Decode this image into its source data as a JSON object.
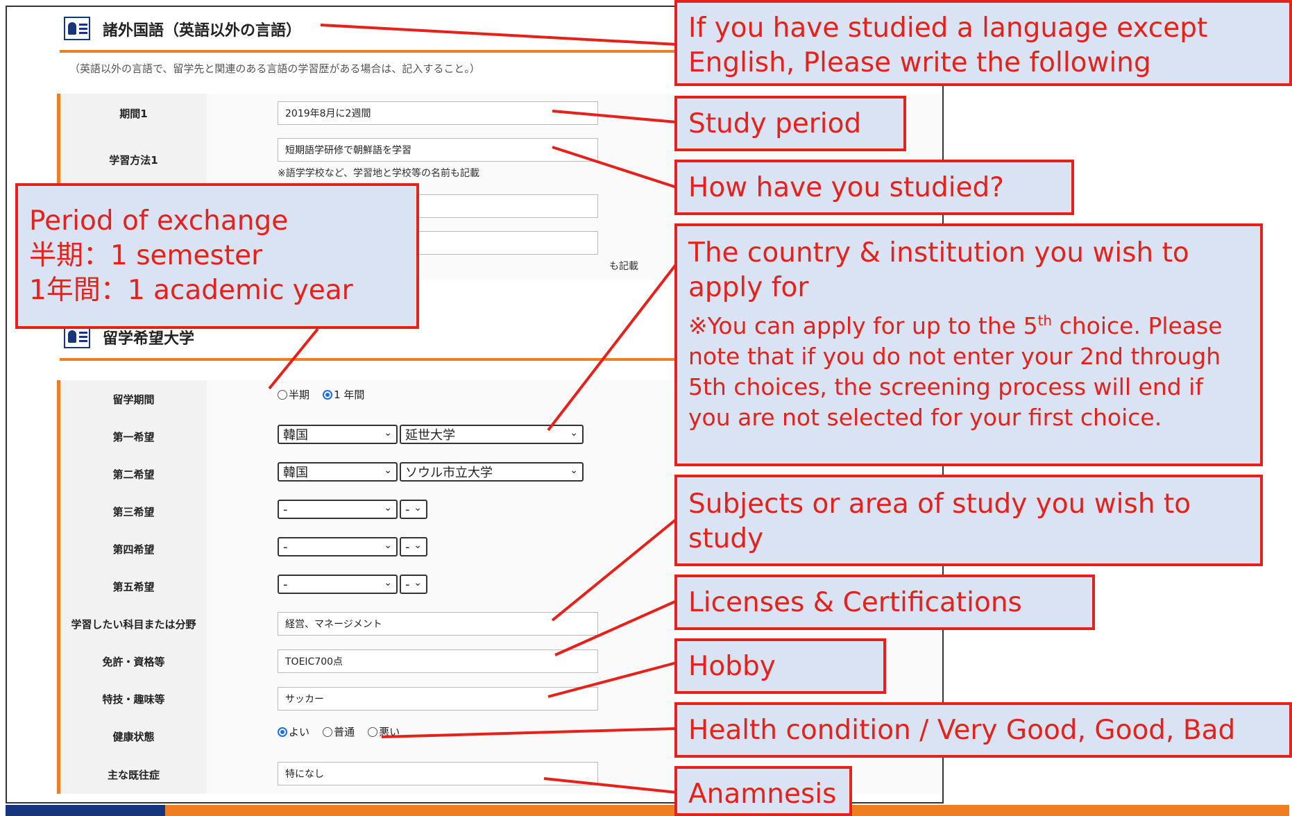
{
  "section1": {
    "title": "諸外国語（英語以外の言語）",
    "note": "（英語以外の言語で、留学先と関連のある言語の学習歴がある場合は、記入すること。）",
    "rows": [
      {
        "label": "期間1",
        "value": "2019年8月に2週間"
      },
      {
        "label": "学習方法1",
        "value": "短期語学研修で朝鮮語を学習",
        "sub": "※語学学校など、学習地と学校等の名前も記載"
      },
      {
        "label": "",
        "value": ""
      },
      {
        "label": "",
        "value": "",
        "sub": "も記載"
      }
    ]
  },
  "section2": {
    "title": "留学希望大学",
    "period": {
      "label": "留学期間",
      "options": [
        "半期",
        "1 年間"
      ],
      "selected": "1 年間"
    },
    "choices": [
      {
        "label": "第一希望",
        "country": "韓国",
        "university": "延世大学"
      },
      {
        "label": "第二希望",
        "country": "韓国",
        "university": "ソウル市立大学"
      },
      {
        "label": "第三希望",
        "country": "-",
        "university": "-"
      },
      {
        "label": "第四希望",
        "country": "-",
        "university": "-"
      },
      {
        "label": "第五希望",
        "country": "-",
        "university": "-"
      }
    ],
    "subjects": {
      "label": "学習したい科目または分野",
      "value": "経営、マネージメント"
    },
    "licenses": {
      "label": "免許・資格等",
      "value": "TOEIC700点"
    },
    "hobby": {
      "label": "特技・趣味等",
      "value": "サッカー"
    },
    "health": {
      "label": "健康状態",
      "options": [
        "よい",
        "普通",
        "悪い"
      ],
      "selected": "よい"
    },
    "history": {
      "label": "主な既往症",
      "value": "特になし"
    }
  },
  "callouts": {
    "language": "If you have studied a language except English,  Please write the following",
    "period": "Study period",
    "method": "How have you studied?",
    "exchange": [
      "Period of exchange",
      "半期：1 semester",
      "1年間：1 academic year"
    ],
    "country_main": "The country & institution you wish to apply for",
    "country_note_a": "※You can apply for up to the 5",
    "country_note_sup": "th",
    "country_note_b": " choice. Please note that if you do not enter your 2nd through 5th choices, the screening process will end if you are not selected for your first choice.",
    "subjects": "Subjects or area of study  you wish to study",
    "licenses": "Licenses & Certifications",
    "hobby": "Hobby",
    "health": "Health condition / Very Good, Good, Bad",
    "anamnesis": "Anamnesis"
  },
  "colors": {
    "accent": "#ef7d22",
    "callout_border": "#e5211a",
    "callout_fill": "#dae3f3",
    "icon": "#16357a",
    "radio": "#1a6fe0"
  }
}
